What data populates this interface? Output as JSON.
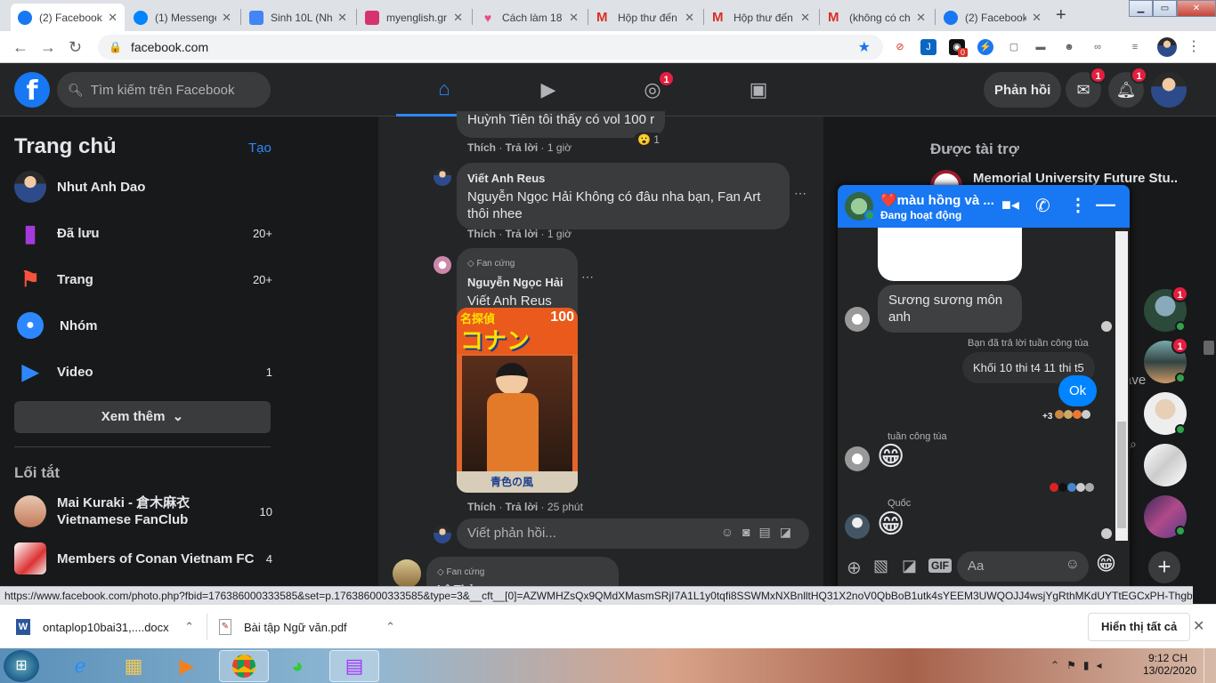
{
  "browser": {
    "tabs": [
      {
        "title": "(2) Facebook",
        "active": true,
        "color": "#1877f2"
      },
      {
        "title": "(1) Messenger",
        "color": "#0084ff"
      },
      {
        "title": "Sinh 10L (Nhi",
        "color": "#4285f4"
      },
      {
        "title": "myenglish.gr",
        "color": "#d6336c"
      },
      {
        "title": "Cách làm 18",
        "color": "#e84c88"
      },
      {
        "title": "Hộp thư đến",
        "color": "#d93025"
      },
      {
        "title": "Hộp thư đến",
        "color": "#d93025"
      },
      {
        "title": "(không có ch",
        "color": "#d93025"
      },
      {
        "title": "(2) Facebook",
        "color": "#1877f2"
      }
    ],
    "url": "facebook.com",
    "ext_badge": "0"
  },
  "header": {
    "search_placeholder": "Tìm kiếm trên Facebook",
    "groups_badge": "1",
    "feedback_label": "Phản hồi",
    "messenger_badge": "1",
    "notif_badge": "1"
  },
  "sidebar": {
    "title": "Trang chủ",
    "create_label": "Tạo",
    "user": "Nhut Anh Dao",
    "items": [
      {
        "label": "Đã lưu",
        "count": "20+"
      },
      {
        "label": "Trang",
        "count": "20+"
      },
      {
        "label": "Nhóm",
        "count": ""
      },
      {
        "label": "Video",
        "count": "1"
      }
    ],
    "see_more": "Xem thêm",
    "shortcuts_title": "Lối tắt",
    "shortcuts": [
      {
        "label": "Mai Kuraki - 倉木麻衣 Vietnamese FanClub",
        "count": "10"
      },
      {
        "label": "Members of Conan Vietnam FC",
        "count": "4"
      }
    ]
  },
  "feed": {
    "c0": {
      "text": "Huỳnh Tiên tôi thấy có vol 100 r",
      "react": "1",
      "like": "Thích",
      "reply": "Trả lời",
      "time": "1 giờ"
    },
    "c1": {
      "name": "Viết Anh Reus",
      "text": "Nguyễn Ngọc Hải Không có đâu nha bạn, Fan Art thôi nhee",
      "like": "Thích",
      "reply": "Trả lời",
      "time": "1 giờ"
    },
    "c2": {
      "badge": "Fan cứng",
      "name": "Nguyễn Ngọc Hải",
      "text": "Viết Anh Reus nè",
      "like": "Thích",
      "reply": "Trả lời",
      "time": "25 phút"
    },
    "cover": {
      "title": "名探偵",
      "logo": "コナン",
      "vol": "100",
      "bottom": "青色の風"
    },
    "reply_placeholder": "Viết phản hồi...",
    "c3": {
      "badge": "Fan cứng",
      "name": "Lê Thảo"
    }
  },
  "right": {
    "sponsored": "Được tài trợ",
    "ad_title": "Memorial University Future Stu...",
    "partial": "ave",
    "contact_badge1": "1",
    "contact_badge2": "1"
  },
  "chat": {
    "name": "❤️màu hồng và ...",
    "status": "Đang hoạt động",
    "msg1": "Sương sương môn anh",
    "reply_note": "Bạn đã trả lời tuần công túa",
    "quoted": "Khối 10 thi t4 11 thi t5",
    "mine": "Ok",
    "seen_more": "+3",
    "sender2": "tuần công túa",
    "emoji2": "😁",
    "sender3": "Quốc",
    "emoji3": "😁",
    "input_placeholder": "Aa",
    "gif": "GIF",
    "send_emoji": "😁"
  },
  "statusbar": "https://www.facebook.com/photo.php?fbid=176386000333585&set=p.176386000333585&type=3&__cft__[0]=AZWMHZsQx9QMdXMasmSRjI7A1L1y0tqfi8SSWMxNXBnlltHQ31X2noV0QbBoB1utk4sYEEM3UWQOJJ4wsjYgRthMKdUYTtEGCxPH-ThgbEs...",
  "downloads": {
    "file1": "ontaplop10bai31,....docx",
    "file2": "Bài tập Ngữ văn.pdf",
    "show_all": "Hiển thị tất cả"
  },
  "taskbar": {
    "time": "9:12 CH",
    "date": "13/02/2020"
  }
}
